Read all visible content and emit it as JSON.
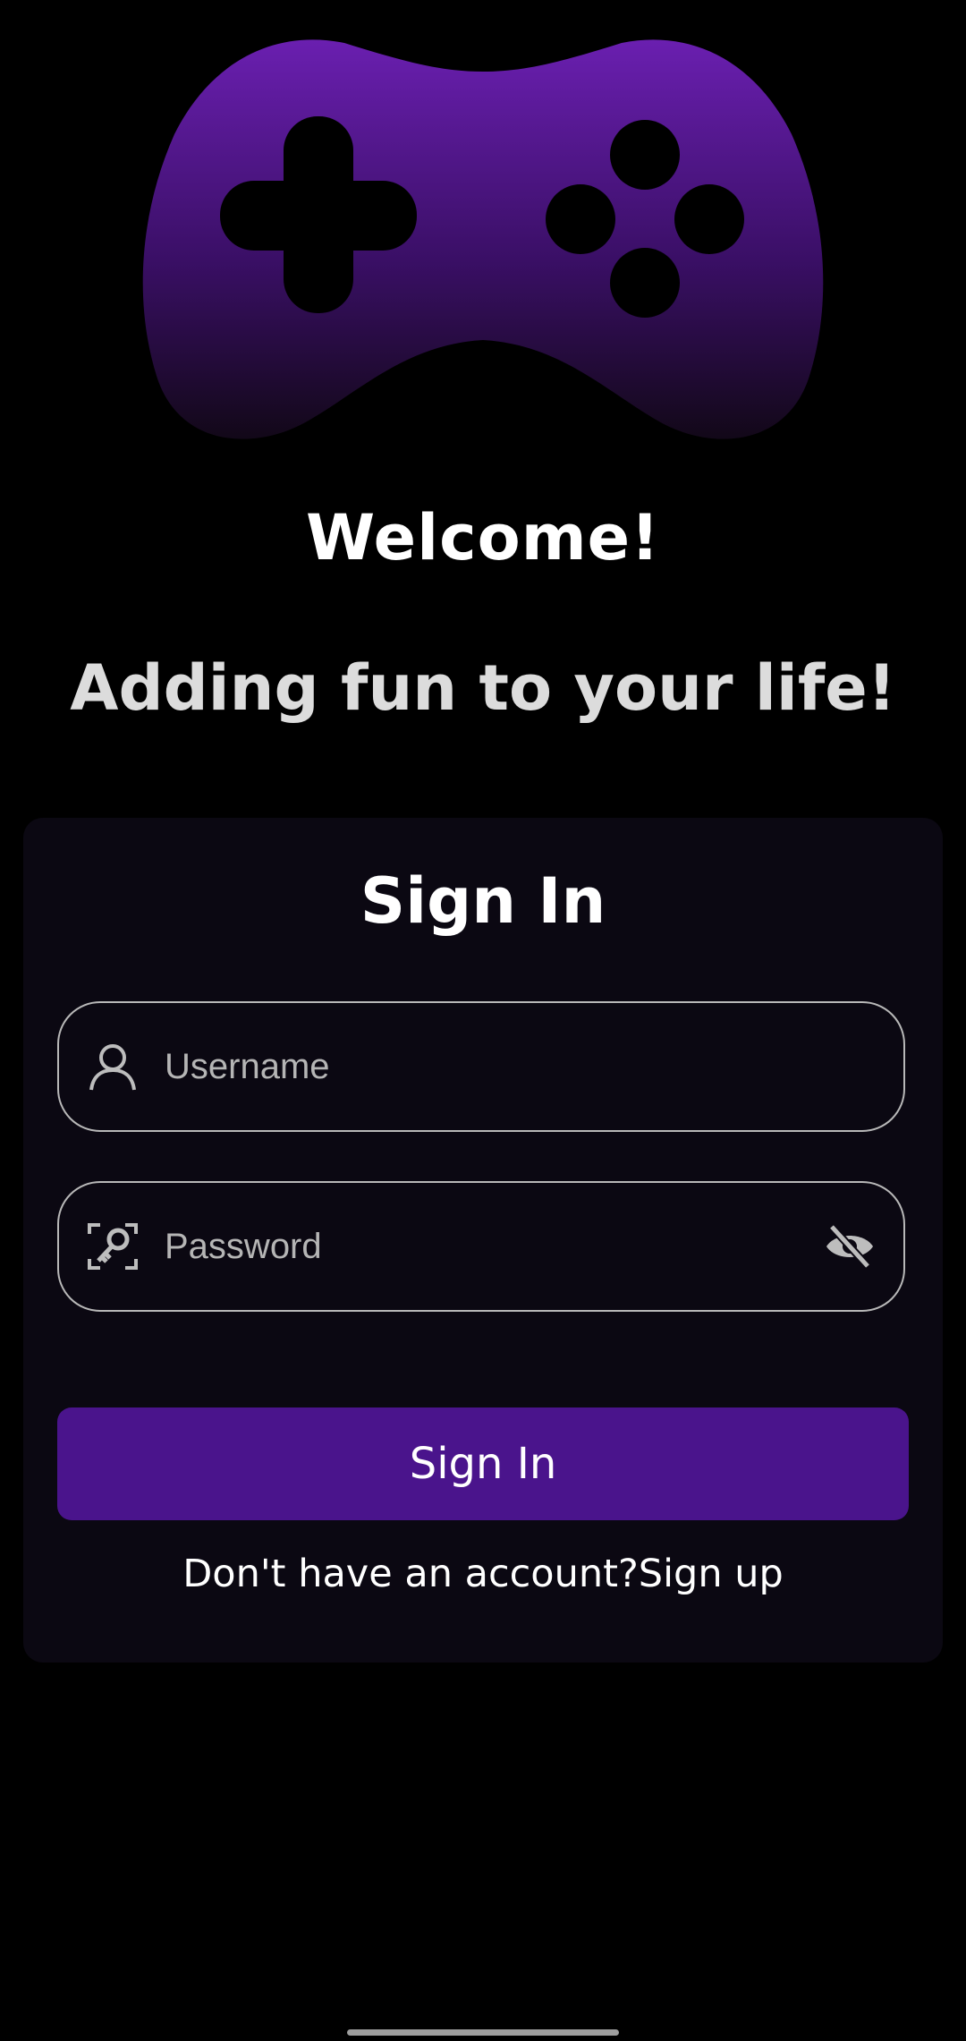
{
  "header": {
    "welcome": "Welcome!",
    "tagline": "Adding fun to your life!"
  },
  "signin": {
    "title": "Sign In",
    "username_placeholder": "Username",
    "password_placeholder": "Password",
    "button_label": "Sign In",
    "no_account_text": "Don't have an account?",
    "signup_link": "Sign up"
  },
  "colors": {
    "accent": "#4a148c",
    "logo_top": "#6a1fb0",
    "card_bg": "#0b0812"
  },
  "icons": [
    "gamepad-logo-icon",
    "user-icon",
    "key-icon",
    "eye-off-icon"
  ]
}
